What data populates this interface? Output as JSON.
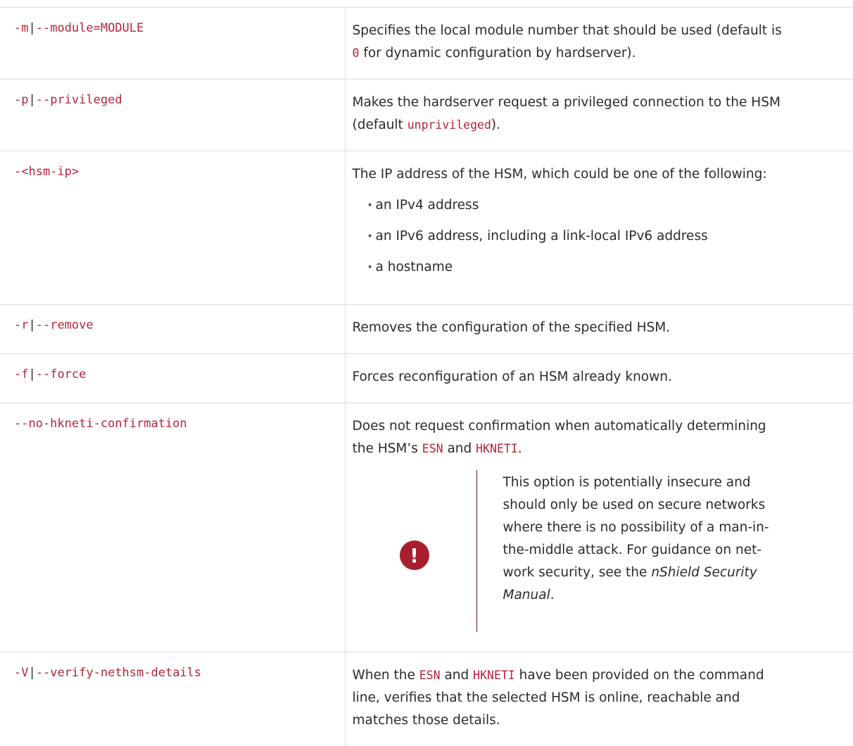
{
  "rows": [
    {
      "option": {
        "p1": "-m",
        "sep": "|",
        "p2": "--module=MODULE"
      },
      "desc": {
        "line1": "Specifies the local module number that should be used (default is",
        "code": "0",
        "line2": " for dynamic configuration by hardserver)."
      }
    },
    {
      "option": {
        "p1": "-p",
        "sep": "|",
        "p2": "--privileged"
      },
      "desc": {
        "line1": "Makes the hardserver request a privileged connection to the HSM",
        "pre": "(default ",
        "code": "unprivileged",
        "post": ")."
      }
    },
    {
      "option": {
        "p1": "-<hsm-ip>"
      },
      "desc": {
        "text": "The IP address of the HSM, which could be one of the following:",
        "bullets": [
          "an IPv4 address",
          "an IPv6 address, including a link-local IPv6 address",
          "a hostname"
        ]
      }
    },
    {
      "option": {
        "p1": "-r",
        "sep": "|",
        "p2": "--remove"
      },
      "desc": {
        "text": "Removes the configuration of the specified HSM."
      }
    },
    {
      "option": {
        "p1": "-f",
        "sep": "|",
        "p2": "--force"
      },
      "desc": {
        "text": "Forces reconfiguration of an HSM already known."
      }
    },
    {
      "option": {
        "p1": "--no-hkneti-confirmation"
      },
      "desc": {
        "line1": "Does not request confirmation when automatically determining",
        "pre": "the HSM’s ",
        "code1": "ESN",
        "mid": " and ",
        "code2": "HKNETI",
        "post": ".",
        "warning": {
          "icon": "!",
          "l1": "This option is potentially insecure and",
          "l2": "should only be used on secure networks",
          "l3": "where there is no possibility of a man-in-",
          "l4": "the-middle attack. For guidance on net-",
          "l5a": "work security, see the ",
          "l5b": "nShield Security",
          "l6": "Manual",
          "l6post": "."
        }
      }
    },
    {
      "option": {
        "p1": "-V",
        "sep": "|",
        "p2": "--verify-nethsm-details"
      },
      "desc": {
        "pre": "When the ",
        "code1": "ESN",
        "mid": " and ",
        "code2": "HKNETI",
        "post": " have been provided on the command",
        "line2": "line, verifies that the selected HSM is online, reachable and",
        "line3": "matches those details."
      }
    }
  ],
  "colors": {
    "code": "#b5243a",
    "warning_icon": "#a81e2e",
    "rule": "#6b1a2a",
    "border": "#dcdcdc"
  },
  "icons": {
    "warning": "exclamation-circle-icon"
  }
}
